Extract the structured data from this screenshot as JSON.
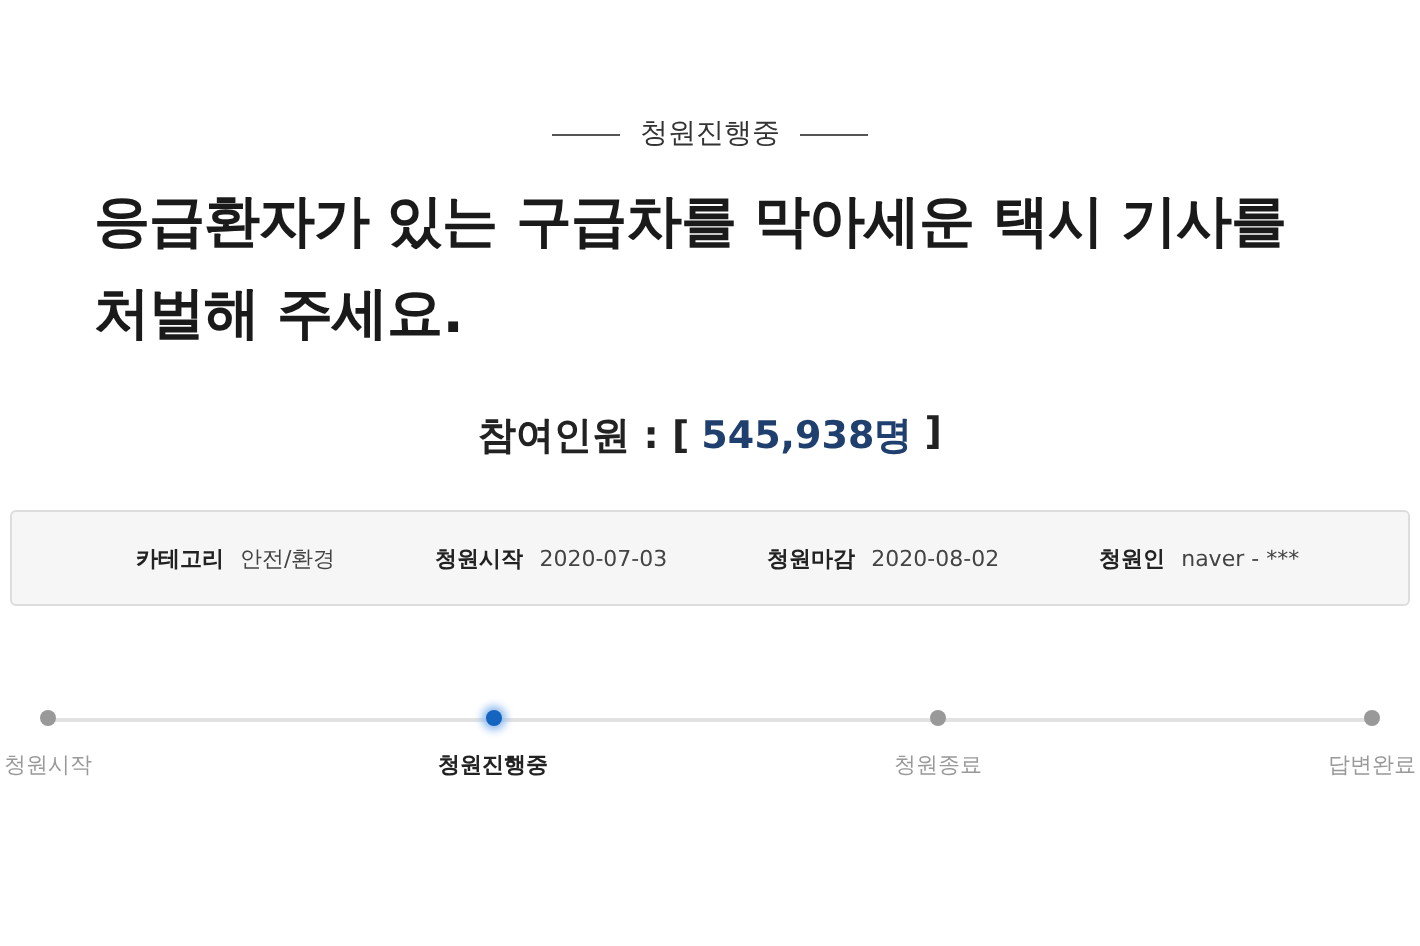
{
  "status": "청원진행중",
  "title": "응급환자가 있는 구급차를 막아세운 택시 기사를 처벌해 주세요.",
  "participants": {
    "label": "참여인원 : [",
    "value": "545,938명",
    "suffix": "]"
  },
  "info": [
    {
      "label": "카테고리",
      "value": "안전/환경"
    },
    {
      "label": "청원시작",
      "value": "2020-07-03"
    },
    {
      "label": "청원마감",
      "value": "2020-08-02"
    },
    {
      "label": "청원인",
      "value": "naver - ***"
    }
  ],
  "steps": [
    {
      "label": "청원시작",
      "selected": false
    },
    {
      "label": "청원진행중",
      "selected": true
    },
    {
      "label": "청원종료",
      "selected": false
    },
    {
      "label": "답변완료",
      "selected": false
    }
  ]
}
